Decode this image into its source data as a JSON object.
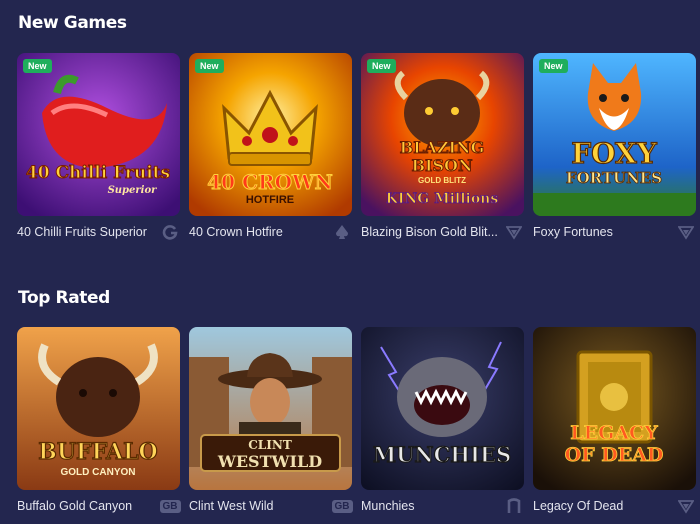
{
  "sections": {
    "new_games": {
      "title": "New Games",
      "games": [
        {
          "name": "40 Chilli Fruits Superior",
          "badge": "New",
          "provider_icon": "g-provider-icon",
          "logo_line1": "40 Chilli Fruits",
          "logo_line2": "Superior"
        },
        {
          "name": "40 Crown Hotfire",
          "badge": "New",
          "provider_icon": "spade-provider-icon",
          "logo_line1": "40 CROWN",
          "logo_line2": "HOTFIRE"
        },
        {
          "name": "Blazing Bison Gold Blit...",
          "badge": "New",
          "provider_icon": "triangle-provider-icon",
          "logo_line1": "BLAZING",
          "logo_line2": "BISON",
          "logo_line3": "GOLD BLITZ",
          "logo_line4": "KING Millions"
        },
        {
          "name": "Foxy Fortunes",
          "badge": "New",
          "provider_icon": "triangle-provider-icon",
          "logo_line1": "FOXY",
          "logo_line2": "FORTUNES"
        }
      ]
    },
    "top_rated": {
      "title": "Top Rated",
      "games": [
        {
          "name": "Buffalo Gold Canyon",
          "provider_label": "GB",
          "provider_icon": "gb-provider-icon",
          "logo_line1": "BUFFALO",
          "logo_line2": "GOLD CANYON"
        },
        {
          "name": "Clint West Wild",
          "provider_label": "GB",
          "provider_icon": "gb-provider-icon",
          "logo_line1": "CLINT",
          "logo_line2": "WESTWILD"
        },
        {
          "name": "Munchies",
          "provider_icon": "n-provider-icon",
          "logo_line1": "MUNCHIES"
        },
        {
          "name": "Legacy Of Dead",
          "provider_icon": "triangle-provider-icon",
          "logo_line1": "LEGACY",
          "logo_line2": "OF DEAD"
        }
      ]
    }
  },
  "colors": {
    "background": "#23264f",
    "badge": "#1fae5c",
    "provider_icon": "#6f7397"
  }
}
